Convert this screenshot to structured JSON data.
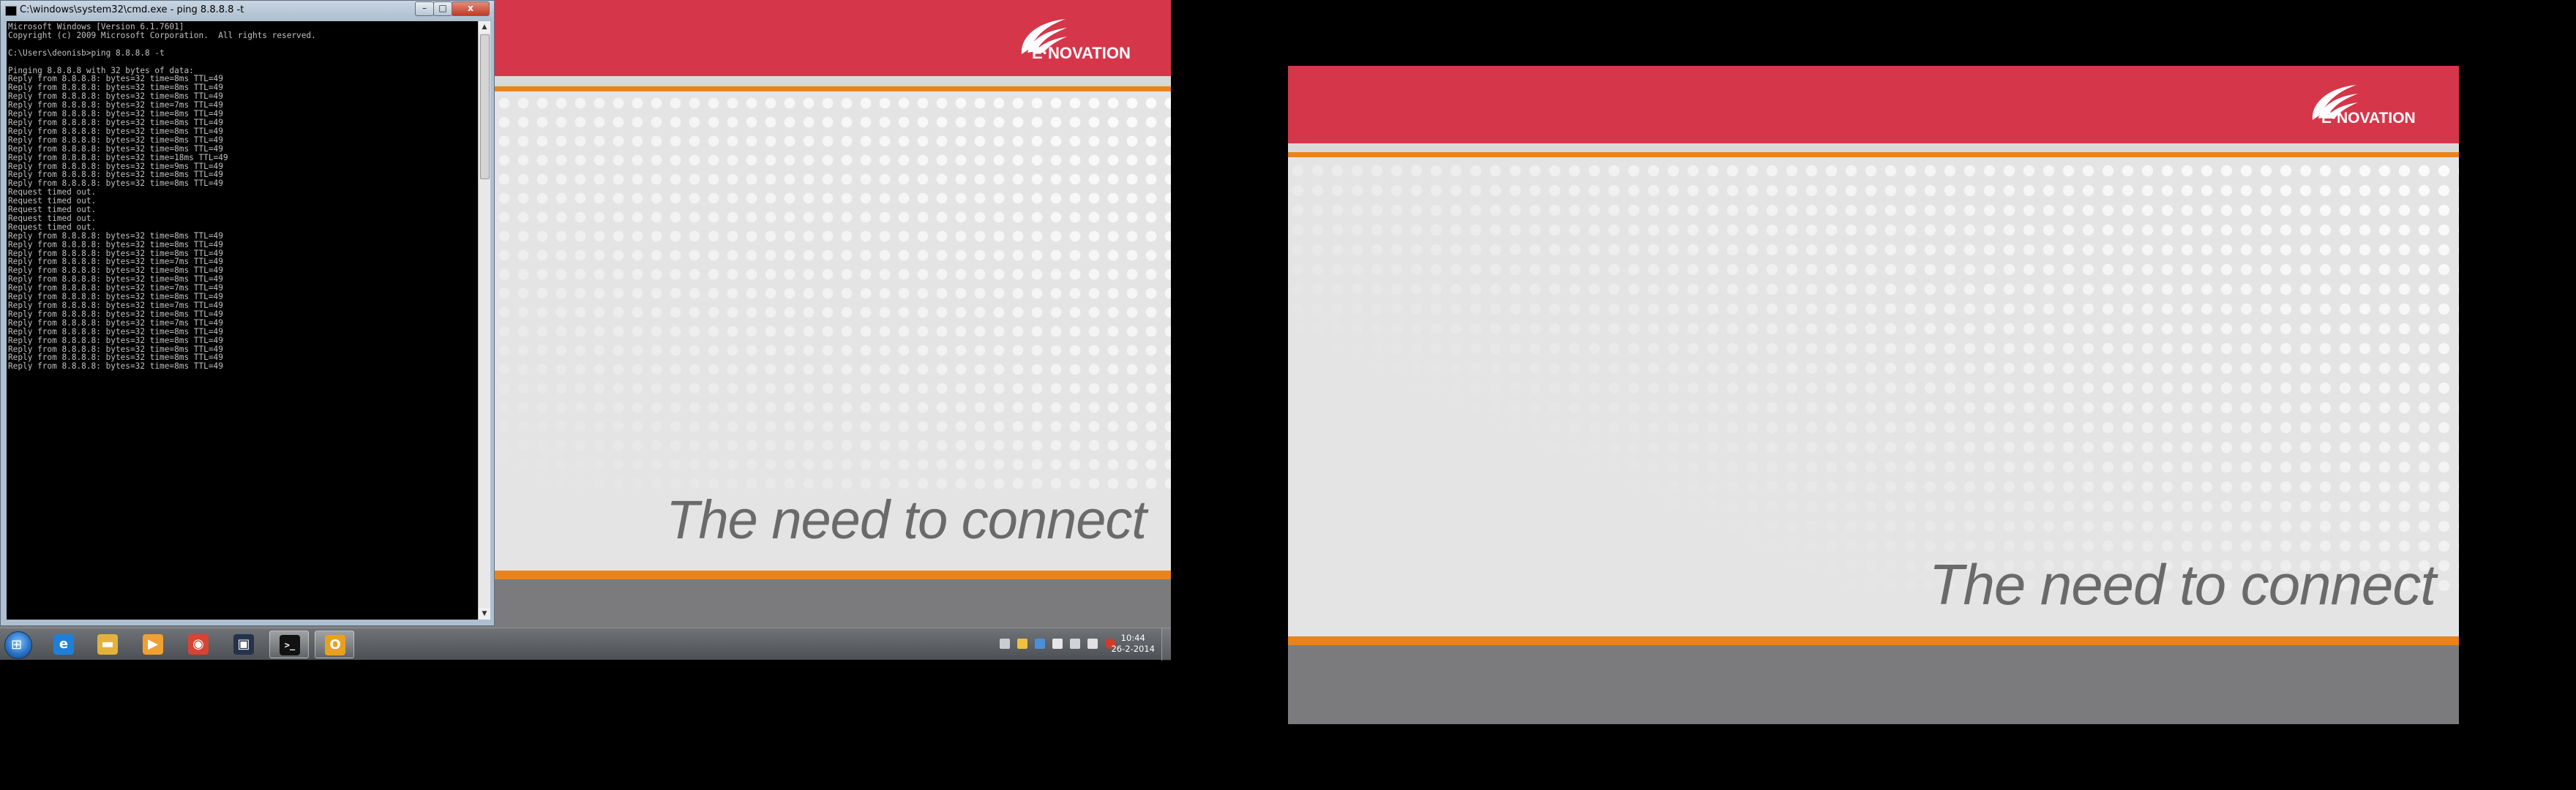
{
  "wallpaper": {
    "logo_text": "E·NOVATION",
    "slogan": "The need to connect",
    "colors": {
      "red": "#d6364a",
      "orange": "#e8841e",
      "gray": "#7b7b7e",
      "background": "#e4e4e4"
    }
  },
  "cmd_window": {
    "title": "C:\\windows\\system32\\cmd.exe - ping  8.8.8.8 -t",
    "controls": {
      "minimize": "–",
      "maximize": "□",
      "close": "x"
    },
    "output": "Microsoft Windows [Version 6.1.7601]\nCopyright (c) 2009 Microsoft Corporation.  All rights reserved.\n\nC:\\Users\\deonisb>ping 8.8.8.8 -t\n\nPinging 8.8.8.8 with 32 bytes of data:\nReply from 8.8.8.8: bytes=32 time=8ms TTL=49\nReply from 8.8.8.8: bytes=32 time=8ms TTL=49\nReply from 8.8.8.8: bytes=32 time=8ms TTL=49\nReply from 8.8.8.8: bytes=32 time=7ms TTL=49\nReply from 8.8.8.8: bytes=32 time=8ms TTL=49\nReply from 8.8.8.8: bytes=32 time=8ms TTL=49\nReply from 8.8.8.8: bytes=32 time=8ms TTL=49\nReply from 8.8.8.8: bytes=32 time=8ms TTL=49\nReply from 8.8.8.8: bytes=32 time=8ms TTL=49\nReply from 8.8.8.8: bytes=32 time=18ms TTL=49\nReply from 8.8.8.8: bytes=32 time=9ms TTL=49\nReply from 8.8.8.8: bytes=32 time=8ms TTL=49\nReply from 8.8.8.8: bytes=32 time=8ms TTL=49\nRequest timed out.\nRequest timed out.\nRequest timed out.\nRequest timed out.\nRequest timed out.\nReply from 8.8.8.8: bytes=32 time=8ms TTL=49\nReply from 8.8.8.8: bytes=32 time=8ms TTL=49\nReply from 8.8.8.8: bytes=32 time=8ms TTL=49\nReply from 8.8.8.8: bytes=32 time=7ms TTL=49\nReply from 8.8.8.8: bytes=32 time=8ms TTL=49\nReply from 8.8.8.8: bytes=32 time=8ms TTL=49\nReply from 8.8.8.8: bytes=32 time=7ms TTL=49\nReply from 8.8.8.8: bytes=32 time=8ms TTL=49\nReply from 8.8.8.8: bytes=32 time=7ms TTL=49\nReply from 8.8.8.8: bytes=32 time=8ms TTL=49\nReply from 8.8.8.8: bytes=32 time=7ms TTL=49\nReply from 8.8.8.8: bytes=32 time=8ms TTL=49\nReply from 8.8.8.8: bytes=32 time=8ms TTL=49\nReply from 8.8.8.8: bytes=32 time=8ms TTL=49\nReply from 8.8.8.8: bytes=32 time=8ms TTL=49\nReply from 8.8.8.8: bytes=32 time=8ms TTL=49"
  },
  "taskbar": {
    "start_icon": "windows-logo-icon",
    "pinned": [
      {
        "icon": "internet-explorer-icon",
        "glyph": "e",
        "color": "#1f7fd8"
      },
      {
        "icon": "file-explorer-icon",
        "glyph": "▬",
        "color": "#e2b23c"
      },
      {
        "icon": "media-player-icon",
        "glyph": "▶",
        "color": "#f0a030"
      },
      {
        "icon": "chrome-icon",
        "glyph": "◉",
        "color": "#d64433"
      },
      {
        "icon": "remote-app-icon",
        "glyph": "▣",
        "color": "#25324a"
      },
      {
        "icon": "command-prompt-icon",
        "glyph": ">_",
        "color": "#111111"
      },
      {
        "icon": "outlook-icon",
        "glyph": "O",
        "color": "#e8a020"
      }
    ],
    "tray": {
      "icons": [
        "keyboard-icon",
        "notes-icon",
        "shield-icon",
        "flag-icon",
        "network-icon",
        "volume-icon",
        "antivirus-icon"
      ],
      "time": "10:44",
      "date": "26-2-2014"
    }
  }
}
